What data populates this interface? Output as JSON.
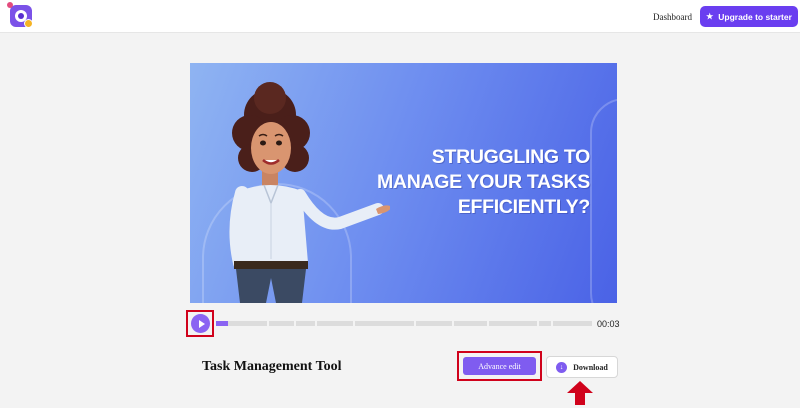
{
  "header": {
    "nav_dashboard": "Dashboard",
    "upgrade_label": "Upgrade to starter",
    "accent": "#6a3ef0"
  },
  "video": {
    "headline_lines": [
      "STRUGGLING TO",
      "MANAGE YOUR TASKS",
      "EFFICIENTLY?"
    ],
    "background_colors": [
      "#8fb4f2",
      "#4a62e6"
    ]
  },
  "player": {
    "time": "00:03",
    "progress_fraction": 0.03,
    "segment_count": 11
  },
  "project": {
    "title": "Task Management Tool",
    "advance_edit_label": "Advance edit",
    "download_label": "Download"
  },
  "annotation": {
    "highlight_color": "#d0021b"
  }
}
